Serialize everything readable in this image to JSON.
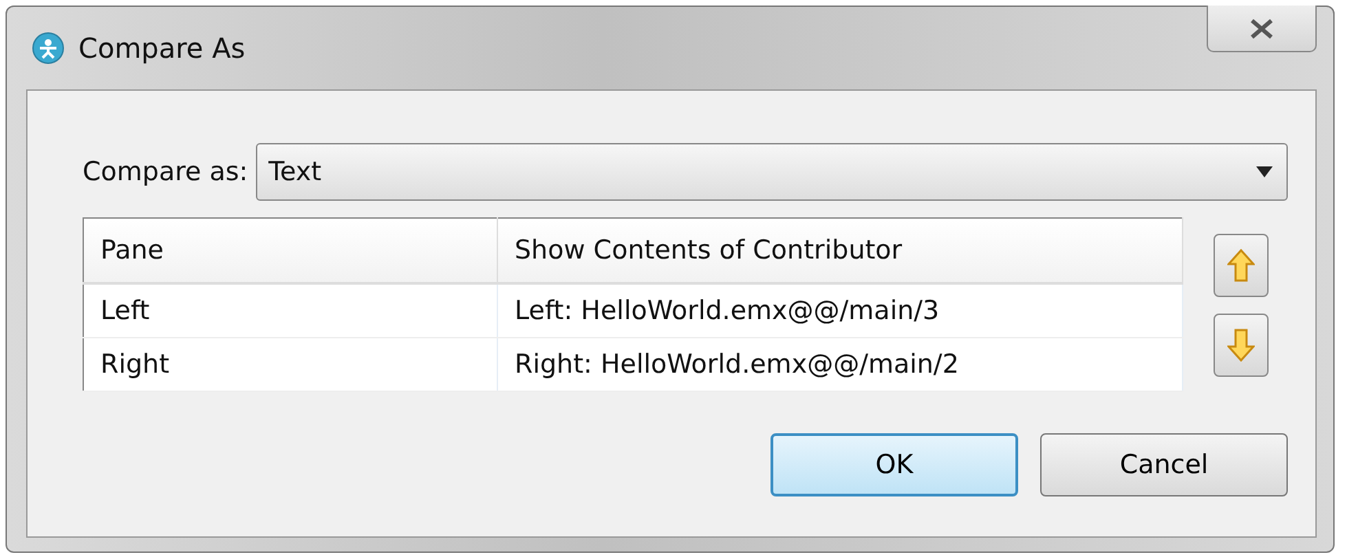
{
  "window": {
    "title": "Compare As"
  },
  "compare_as": {
    "label": "Compare as:",
    "value": "Text"
  },
  "table": {
    "columns": [
      "Pane",
      "Show Contents of Contributor"
    ],
    "rows": [
      [
        "Left",
        "Left: HelloWorld.emx@@/main/3"
      ],
      [
        "Right",
        "Right: HelloWorld.emx@@/main/2"
      ]
    ]
  },
  "buttons": [
    {
      "label": "OK",
      "default": true
    },
    {
      "label": "Cancel",
      "default": false
    }
  ]
}
